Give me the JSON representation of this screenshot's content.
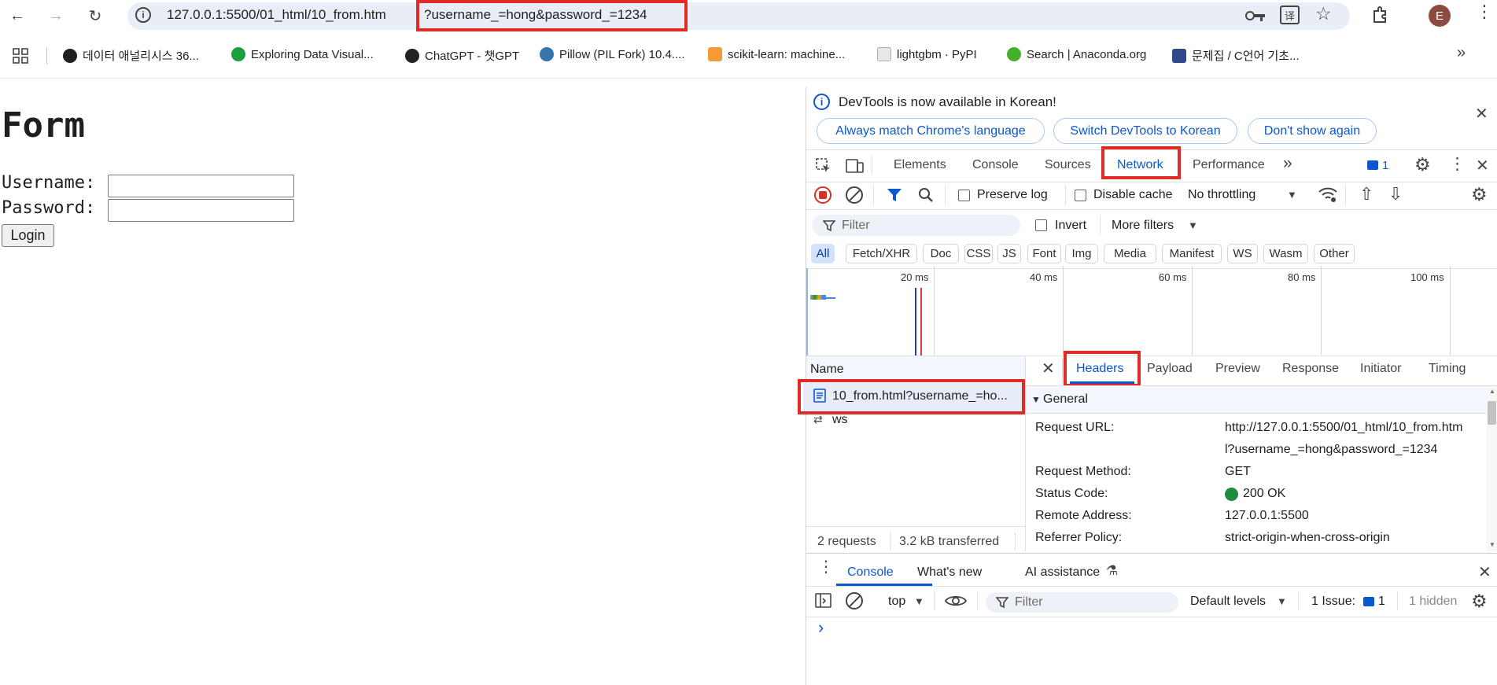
{
  "browser": {
    "url_base": "127.0.0.1:5500/01_html/10_from.htm",
    "url_query": "?username_=hong&password_=1234",
    "profile_initial": "E"
  },
  "bookmarks": [
    {
      "label": "데이터 애널리시스 36...",
      "icon": "github-icon",
      "color": "#1f1f1f"
    },
    {
      "label": "Exploring Data Visual...",
      "icon": "diamond-icon",
      "color": "#1a9e3f"
    },
    {
      "label": "ChatGPT - 챗GPT",
      "icon": "openai-icon",
      "color": "#222222"
    },
    {
      "label": "Pillow (PIL Fork) 10.4....",
      "icon": "python-icon",
      "color": "#3776ab"
    },
    {
      "label": "scikit-learn: machine...",
      "icon": "chart-icon",
      "color": "#f89939"
    },
    {
      "label": "lightgbm · PyPI",
      "icon": "cube-icon",
      "color": "#aaaaaa"
    },
    {
      "label": "Search | Anaconda.org",
      "icon": "anaconda-icon",
      "color": "#43b02a"
    },
    {
      "label": "문제집 / C언어 기초...",
      "icon": "c-icon",
      "color": "#2e4a8b"
    }
  ],
  "page": {
    "title": "Form",
    "username_label": "Username:",
    "password_label": "Password:",
    "login_label": "Login"
  },
  "devtools": {
    "notice": "DevTools is now available in Korean!",
    "btn_match": "Always match Chrome's language",
    "btn_switch": "Switch DevTools to Korean",
    "btn_dont_show": "Don't show again",
    "tabs": [
      "Elements",
      "Console",
      "Sources",
      "Network",
      "Performance"
    ],
    "active_tab": "Network",
    "issue_count": "1",
    "preserve_log": "Preserve log",
    "disable_cache": "Disable cache",
    "throttling": "No throttling",
    "filter_placeholder": "Filter",
    "invert": "Invert",
    "more_filters": "More filters",
    "type_filters": [
      "All",
      "Fetch/XHR",
      "Doc",
      "CSS",
      "JS",
      "Font",
      "Img",
      "Media",
      "Manifest",
      "WS",
      "Wasm",
      "Other"
    ],
    "timeline_ticks": [
      "20 ms",
      "40 ms",
      "60 ms",
      "80 ms",
      "100 ms"
    ],
    "name_header": "Name",
    "requests": [
      {
        "name": "10_from.html?username_=ho...",
        "icon": "document-icon"
      },
      {
        "name": "ws",
        "icon": "websocket-icon"
      }
    ],
    "summary": {
      "requests": "2 requests",
      "transferred": "3.2 kB transferred"
    },
    "detail_tabs": [
      "Headers",
      "Payload",
      "Preview",
      "Response",
      "Initiator",
      "Timing"
    ],
    "active_detail_tab": "Headers",
    "general_section": "General",
    "general": {
      "request_url_key": "Request URL:",
      "request_url_1": "http://127.0.0.1:5500/01_html/10_from.htm",
      "request_url_2": "l?username_=hong&password_=1234",
      "method_key": "Request Method:",
      "method": "GET",
      "status_key": "Status Code:",
      "status": "200 OK",
      "remote_key": "Remote Address:",
      "remote": "127.0.0.1:5500",
      "referrer_key": "Referrer Policy:",
      "referrer": "strict-origin-when-cross-origin"
    },
    "drawer": {
      "tabs": [
        "Console",
        "What's new",
        "AI assistance"
      ],
      "context": "top",
      "filter_placeholder": "Filter",
      "levels": "Default levels",
      "issues_label": "1 Issue:",
      "issues_count": "1",
      "hidden": "1 hidden",
      "prompt": "›"
    },
    "colors": {
      "accent": "#0b57d0",
      "highlight": "#e02b27",
      "status_ok": "#1e8e3e"
    }
  }
}
